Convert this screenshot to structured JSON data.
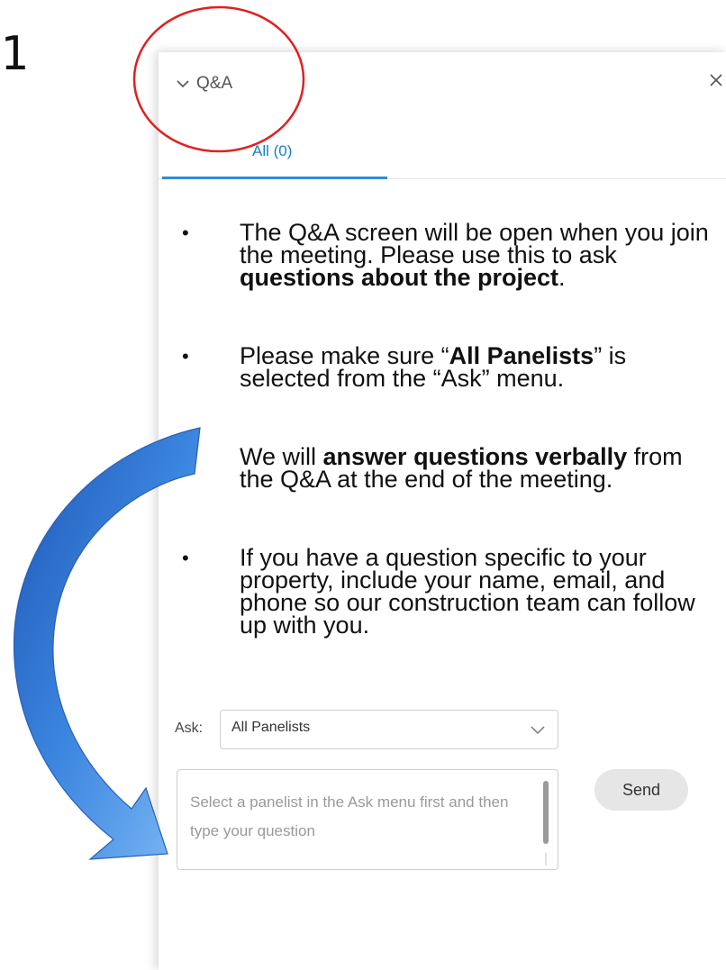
{
  "corner_fragment": "1",
  "panel": {
    "title": "Q&A",
    "tab_all_label": "All (0)"
  },
  "instructions": {
    "bullet_char": "•",
    "items": [
      {
        "t1": "The Q&A screen will be open when you join the meeting. Please use this to ask ",
        "b1": "questions about the project",
        "t2": "."
      },
      {
        "t1": "Please make sure “",
        "b1": "All Panelists",
        "t2": "” is selected from the “Ask” menu."
      },
      {
        "t1": "We will ",
        "b1": "answer questions verbally",
        "t2": " from the Q&A at the end of the meeting."
      },
      {
        "t1": "If you have a question specific to your property, include your name, email, and phone so our construction team can follow up with you.",
        "b1": "",
        "t2": ""
      }
    ]
  },
  "ask": {
    "label": "Ask:",
    "selected": "All Panelists"
  },
  "question": {
    "placeholder": "Select a panelist in the Ask menu first and then type your question",
    "value": ""
  },
  "send_label": "Send",
  "colors": {
    "accent": "#2e8bd6",
    "tab_text": "#1a7fc4",
    "highlight_circle": "#e02020",
    "arrow": "#3a7fd8"
  },
  "icons": {
    "collapse": "chevron-down-icon",
    "close": "close-icon",
    "dropdown": "chevron-down-icon",
    "arrow": "curved-arrow-icon",
    "highlight": "highlight-circle"
  }
}
